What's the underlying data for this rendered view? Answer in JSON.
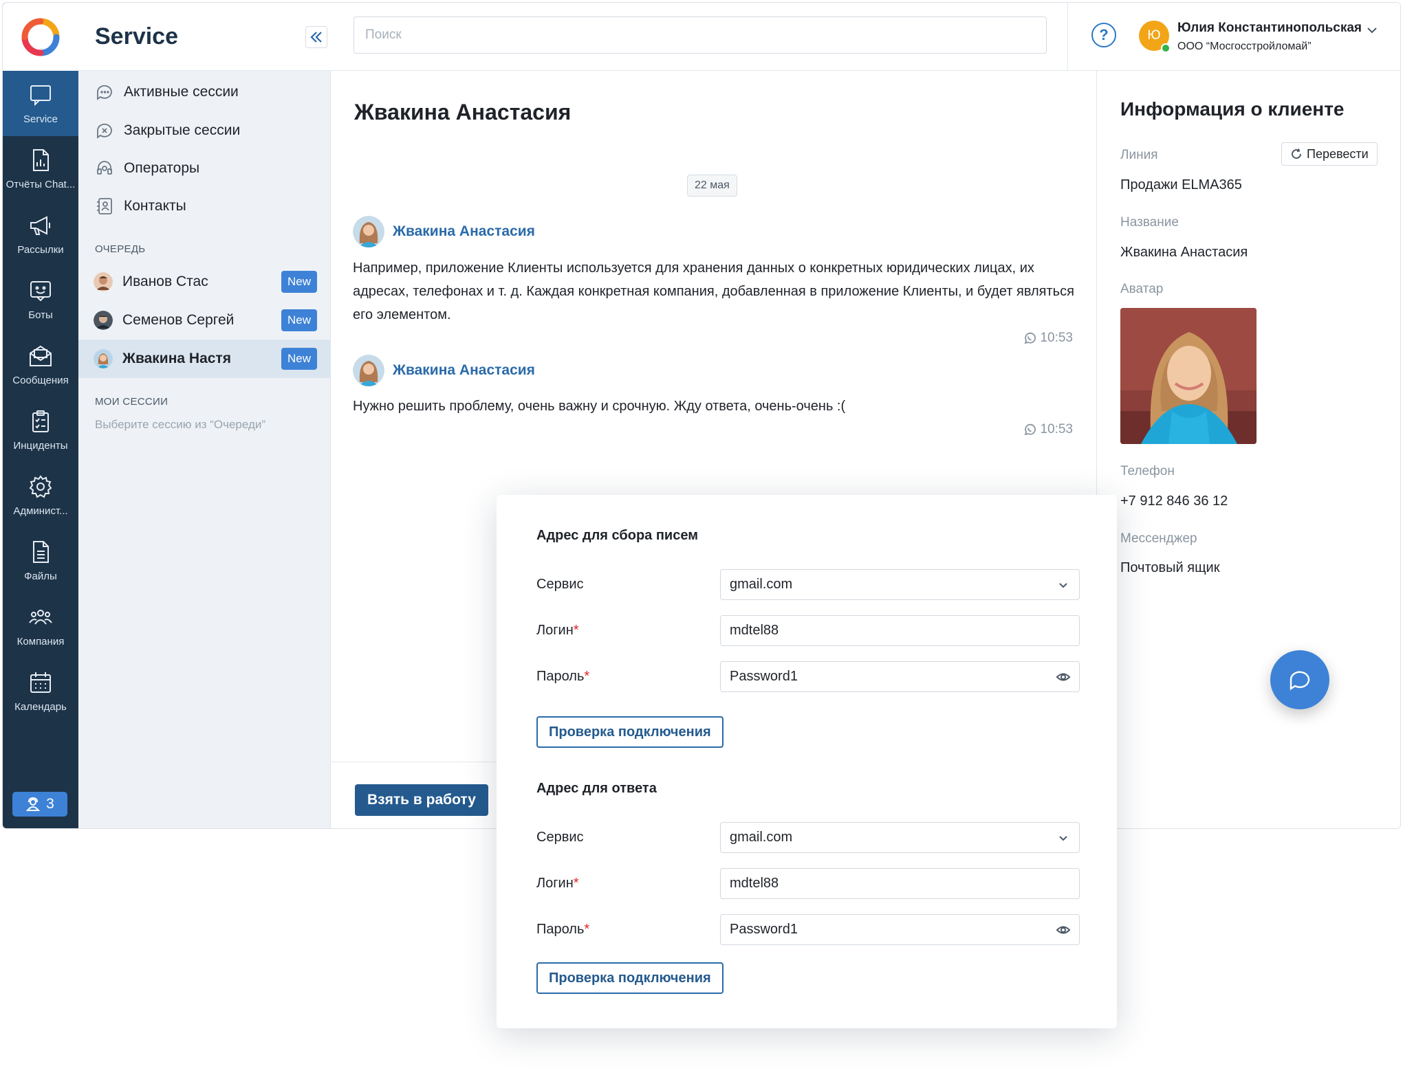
{
  "rail": {
    "items": [
      {
        "label": "Service",
        "icon": "chat-icon"
      },
      {
        "label": "Отчёты Chat...",
        "icon": "report-icon"
      },
      {
        "label": "Рассылки",
        "icon": "megaphone-icon"
      },
      {
        "label": "Боты",
        "icon": "bot-icon"
      },
      {
        "label": "Сообщения",
        "icon": "mail-icon"
      },
      {
        "label": "Инциденты",
        "icon": "clipboard-icon"
      },
      {
        "label": "Админист...",
        "icon": "gear-icon"
      },
      {
        "label": "Файлы",
        "icon": "file-icon"
      },
      {
        "label": "Компания",
        "icon": "people-icon"
      },
      {
        "label": "Календарь",
        "icon": "calendar-icon"
      }
    ],
    "operators_count": "3"
  },
  "sidebar": {
    "title": "Service",
    "nav": [
      {
        "label": "Активные сессии",
        "icon": "chat-dots-icon"
      },
      {
        "label": "Закрытые сессии",
        "icon": "chat-closed-icon"
      },
      {
        "label": "Операторы",
        "icon": "headset-icon"
      },
      {
        "label": "Контакты",
        "icon": "contact-book-icon"
      }
    ],
    "queue_label": "ОЧЕРЕДЬ",
    "queue": [
      {
        "name": "Иванов Стас",
        "badge": "New"
      },
      {
        "name": "Семенов Сергей",
        "badge": "New"
      },
      {
        "name": "Жвакина Настя",
        "badge": "New"
      }
    ],
    "my_sessions_label": "МОИ СЕССИИ",
    "my_sessions_hint": "Выберите сессию из  “Очереди”"
  },
  "topbar": {
    "search_placeholder": "Поиск",
    "help": "?",
    "user_initial": "Ю",
    "user_name": "Юлия Константинопольская",
    "user_org": "ООО “Мосгосстройломай”"
  },
  "chat": {
    "title": "Жвакина Анастасия",
    "date": "22 мая",
    "messages": [
      {
        "author": "Жвакина Анастасия",
        "text": "Например, приложение Клиенты используется для хранения данных о конкретных юридических лицах, их адресах, телефонах и т. д. Каждая конкретная компания, добавленная в приложение Клиенты, и будет являться его элементом.",
        "time": "10:53"
      },
      {
        "author": "Жвакина Анастасия",
        "text": "Нужно решить проблему, очень важну и срочную. Жду ответа, очень-очень  :(",
        "time": "10:53"
      }
    ],
    "take_button": "Взять в работу"
  },
  "client_info": {
    "title": "Информация о клиенте",
    "line_label": "Линия",
    "translate_button": "Перевести",
    "line_value": "Продажи ELMA365",
    "name_label": "Название",
    "name_value": "Жвакина Анастасия",
    "avatar_label": "Аватар",
    "phone_label": "Телефон",
    "phone_value": "+7 912 846 36 12",
    "messenger_label": "Мессенджер",
    "messenger_value": "Почтовый ящик"
  },
  "mail_form": {
    "incoming": {
      "heading": "Адрес для сбора писем",
      "service_label": "Сервис",
      "service_value": "gmail.com",
      "login_label": "Логин",
      "login_value": "mdtel88",
      "password_label": "Пароль",
      "password_value": "Password1",
      "check_button": "Проверка подключения"
    },
    "outgoing": {
      "heading": "Адрес для ответа",
      "service_label": "Сервис",
      "service_value": "gmail.com",
      "login_label": "Логин",
      "login_value": "mdtel88",
      "password_label": "Пароль",
      "password_value": "Password1",
      "check_button": "Проверка подключения"
    },
    "required_mark": "*"
  },
  "colors": {
    "rail_bg": "#1d3348",
    "rail_active": "#245a8e",
    "accent": "#3d82d6",
    "link": "#2a6aa9",
    "sidebar_bg": "#eef2f6"
  }
}
